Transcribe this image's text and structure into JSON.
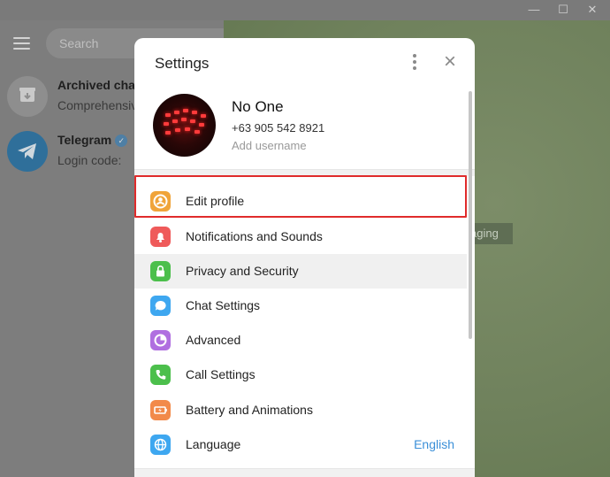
{
  "window": {
    "minimize_icon": "minimize-icon",
    "maximize_icon": "maximize-icon",
    "close_icon": "close-icon"
  },
  "sidebar": {
    "search_placeholder": "Search",
    "chats": [
      {
        "title": "Archived chats",
        "subtitle": "Comprehensive",
        "icon": "archive-icon",
        "color": "#8a8a8a"
      },
      {
        "title": "Telegram",
        "subtitle": "Login code: ",
        "icon": "telegram-icon",
        "color": "#2f6f9a",
        "verified": true
      }
    ]
  },
  "chat_area": {
    "pill_text": "aging"
  },
  "settings": {
    "title": "Settings",
    "profile": {
      "name": "No One",
      "phone": "+63 905 542 8921",
      "username_placeholder": "Add username"
    },
    "menu": [
      {
        "label": "Edit profile",
        "icon": "user-icon",
        "color": "#f0a43a",
        "highlighted": true
      },
      {
        "label": "Notifications and Sounds",
        "icon": "bell-icon",
        "color": "#ef5a5a"
      },
      {
        "label": "Privacy and Security",
        "icon": "lock-icon",
        "color": "#4cbf4c",
        "hovered": true
      },
      {
        "label": "Chat Settings",
        "icon": "chat-bubble-icon",
        "color": "#3ea7f0"
      },
      {
        "label": "Advanced",
        "icon": "pie-chart-icon",
        "color": "#b06fe0"
      },
      {
        "label": "Call Settings",
        "icon": "phone-icon",
        "color": "#4cbf4c"
      },
      {
        "label": "Battery and Animations",
        "icon": "battery-icon",
        "color": "#f28a4a"
      },
      {
        "label": "Language",
        "icon": "globe-icon",
        "color": "#3ea7f0",
        "value": "English"
      }
    ]
  }
}
